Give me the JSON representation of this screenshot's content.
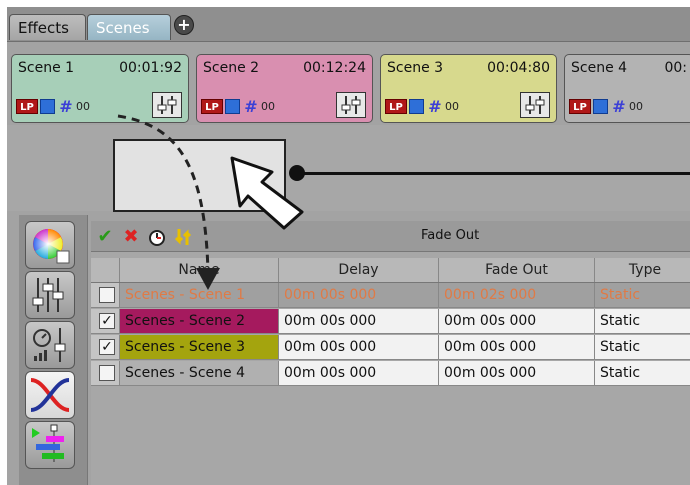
{
  "tabs": [
    {
      "label": "Effects"
    },
    {
      "label": "Scenes"
    }
  ],
  "scenes": [
    {
      "name": "Scene 1",
      "time": "00:01:92",
      "count": "00",
      "color": "#a7cfb8"
    },
    {
      "name": "Scene 2",
      "time": "00:12:24",
      "count": "00",
      "color": "#d98fb0"
    },
    {
      "name": "Scene 3",
      "time": "00:04:80",
      "count": "00",
      "color": "#d7d98d"
    },
    {
      "name": "Scene 4",
      "time": "00:",
      "count": "00",
      "color": "#b3b3b3"
    }
  ],
  "toolbar": {
    "title": "Fade Out",
    "icons": [
      "checkmark-icon",
      "delete-icon",
      "clock-icon",
      "swap-icon"
    ]
  },
  "table": {
    "headers": [
      "Name",
      "Delay",
      "Fade Out",
      "Type"
    ],
    "rows": [
      {
        "checked": false,
        "name": "Scenes - Scene 1",
        "delay": "00m 00s 000",
        "fade": "00m 02s 000",
        "type": "Static",
        "nameBg": "#a0a0a0",
        "textColor": "#e07a45"
      },
      {
        "checked": true,
        "name": "Scenes - Scene 2",
        "delay": "00m 00s 000",
        "fade": "00m 00s 000",
        "type": "Static",
        "nameBg": "#a51a5e",
        "textColor": "#111111"
      },
      {
        "checked": true,
        "name": "Scenes - Scene 3",
        "delay": "00m 00s 000",
        "fade": "00m 00s 000",
        "type": "Static",
        "nameBg": "#a4a40e",
        "textColor": "#111111"
      },
      {
        "checked": false,
        "name": "Scenes - Scene 4",
        "delay": "00m 00s 000",
        "fade": "00m 00s 000",
        "type": "Static",
        "nameBg": "#b0b0b0",
        "textColor": "#111111"
      }
    ]
  },
  "leftTools": [
    "color-wheel-icon",
    "sliders-icon",
    "fader-speed-icon",
    "crossfade-icon",
    "timeline-icon"
  ]
}
